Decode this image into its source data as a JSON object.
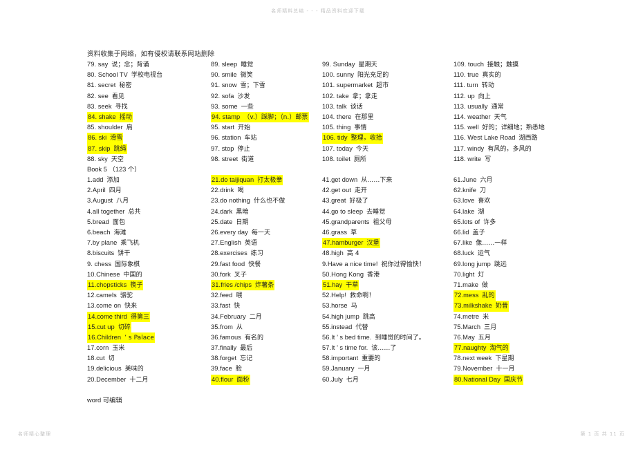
{
  "document": {
    "header_watermark": "名师精料总结 - - - 精品资料欢迎下载",
    "footer_left_watermark": "名师精心整理",
    "footer_right_watermark": "第 1 页 共 11 页",
    "notice": "资料收集于网络，如有侵权请联系网站删除",
    "book_heading": "Book 5  （123 个）",
    "edit_note": "word 可编辑"
  },
  "columns": [
    {
      "id": "column-1",
      "entries": [
        {
          "en": "79. say",
          "cn": "说；念；背诵",
          "hl": false
        },
        {
          "en": "80. School TV",
          "cn": "学校电视台",
          "hl": false
        },
        {
          "en": "81. secret",
          "cn": "秘密",
          "hl": false
        },
        {
          "en": "82. see",
          "cn": "看见",
          "hl": false
        },
        {
          "en": "83. seek",
          "cn": "寻找",
          "hl": false
        },
        {
          "en": "84. shake",
          "cn": "摇动",
          "hl": true
        },
        {
          "en": "85. shoulder",
          "cn": "肩",
          "hl": false
        },
        {
          "en": "86. ski",
          "cn": "滑雪",
          "hl": true
        },
        {
          "en": "87. skip",
          "cn": "跳绳",
          "hl": true
        },
        {
          "en": "88. sky",
          "cn": "天空",
          "hl": false
        },
        {
          "en": "__BOOK_HEAD__",
          "cn": "",
          "hl": false
        },
        {
          "en": "1.add",
          "cn": "添加",
          "hl": false
        },
        {
          "en": "2.April",
          "cn": "四月",
          "hl": false
        },
        {
          "en": "3.August",
          "cn": "八月",
          "hl": false
        },
        {
          "en": "4.all together",
          "cn": "总共",
          "hl": false
        },
        {
          "en": "5.bread",
          "cn": "面包",
          "hl": false
        },
        {
          "en": "6.beach",
          "cn": "海滩",
          "hl": false
        },
        {
          "en": "7.by plane",
          "cn": "乘飞机",
          "hl": false
        },
        {
          "en": "8.biscuits",
          "cn": "饼干",
          "hl": false
        },
        {
          "en": "9. chess",
          "cn": "国际象棋",
          "hl": false
        },
        {
          "en": "10.Chinese",
          "cn": "中国的",
          "hl": false
        },
        {
          "en": "11.chopsticks",
          "cn": "筷子",
          "hl": true
        },
        {
          "en": "12.camels",
          "cn": "骆驼",
          "hl": false
        },
        {
          "en": "13.come on",
          "cn": "快来",
          "hl": false
        },
        {
          "en": "14.come third",
          "cn": "得第三",
          "hl": true
        },
        {
          "en": "15.cut up",
          "cn": "切碎",
          "hl": true
        },
        {
          "en": "16.Children",
          "cn": "’  s Palace",
          "hl": true
        },
        {
          "en": "17.corn",
          "cn": "玉米",
          "hl": false
        },
        {
          "en": "18.cut",
          "cn": "切",
          "hl": false
        },
        {
          "en": "19.delicious",
          "cn": "美味的",
          "hl": false
        },
        {
          "en": "20.December",
          "cn": "十二月",
          "hl": false
        },
        {
          "en": "__EDIT_NOTE__",
          "cn": "",
          "hl": false
        }
      ]
    },
    {
      "id": "column-2",
      "entries": [
        {
          "en": "89. sleep",
          "cn": "睡觉",
          "hl": false
        },
        {
          "en": "90. smile",
          "cn": "微笑",
          "hl": false
        },
        {
          "en": "91. snow",
          "cn": "雪；下雪",
          "hl": false
        },
        {
          "en": "92. sofa",
          "cn": "沙发",
          "hl": false
        },
        {
          "en": "93. some",
          "cn": "一些",
          "hl": false
        },
        {
          "en": "94. stamp",
          "cn": "（v.）踩脚；（n.）邮票",
          "hl": true
        },
        {
          "en": "95. start",
          "cn": "开始",
          "hl": false
        },
        {
          "en": "96. station",
          "cn": "车站",
          "hl": false
        },
        {
          "en": "97. stop",
          "cn": "停止",
          "hl": false
        },
        {
          "en": "98. street",
          "cn": "街道",
          "hl": false
        },
        {
          "en": "__SPACER__",
          "cn": "",
          "hl": false
        },
        {
          "en": "21.do taijiquan",
          "cn": "打太极拳",
          "hl": true
        },
        {
          "en": "22.drink",
          "cn": "喝",
          "hl": false
        },
        {
          "en": "23.do nothing",
          "cn": "什么也不做",
          "hl": false
        },
        {
          "en": "24.dark",
          "cn": "黑暗",
          "hl": false
        },
        {
          "en": "25.date",
          "cn": "日期",
          "hl": false
        },
        {
          "en": "26.every day",
          "cn": "每一天",
          "hl": false
        },
        {
          "en": "27.English",
          "cn": "英语",
          "hl": false
        },
        {
          "en": "28.exercises",
          "cn": "练习",
          "hl": false
        },
        {
          "en": "29.fast food",
          "cn": "快餐",
          "hl": false
        },
        {
          "en": "30.fork",
          "cn": "叉子",
          "hl": false
        },
        {
          "en": "31.fries /chips",
          "cn": "炸薯条",
          "hl": true
        },
        {
          "en": "32.feed",
          "cn": "喂",
          "hl": false
        },
        {
          "en": "33.fast",
          "cn": "快",
          "hl": false
        },
        {
          "en": "34.February",
          "cn": "二月",
          "hl": false
        },
        {
          "en": "35.from",
          "cn": "从",
          "hl": false
        },
        {
          "en": "36.famous",
          "cn": "有名的",
          "hl": false
        },
        {
          "en": "37.finally",
          "cn": "最后",
          "hl": false
        },
        {
          "en": "38.forget",
          "cn": "忘记",
          "hl": false
        },
        {
          "en": "39.face",
          "cn": "脸",
          "hl": false
        },
        {
          "en": "40.flour",
          "cn": "面粉",
          "hl": true
        }
      ]
    },
    {
      "id": "column-3",
      "entries": [
        {
          "en": "99. Sunday",
          "cn": "星期天",
          "hl": false
        },
        {
          "en": "100. sunny",
          "cn": "阳光充足的",
          "hl": false
        },
        {
          "en": "101. supermarket",
          "cn": "超市",
          "hl": false
        },
        {
          "en": "102. take",
          "cn": "拿；拿走",
          "hl": false
        },
        {
          "en": "103. talk",
          "cn": "谈话",
          "hl": false
        },
        {
          "en": "104. there",
          "cn": "在那里",
          "hl": false
        },
        {
          "en": "105. thing",
          "cn": "事情",
          "hl": false
        },
        {
          "en": "106. tidy",
          "cn": "整理，收拾",
          "hl": true
        },
        {
          "en": "107. today",
          "cn": "今天",
          "hl": false
        },
        {
          "en": "108. toilet",
          "cn": "厕所",
          "hl": false
        },
        {
          "en": "__SPACER__",
          "cn": "",
          "hl": false
        },
        {
          "en": "41.get down",
          "cn": "从……下来",
          "hl": false
        },
        {
          "en": "42.get out",
          "cn": "走开",
          "hl": false
        },
        {
          "en": "43.great",
          "cn": "好极了",
          "hl": false
        },
        {
          "en": "44.go to sleep",
          "cn": "去睡觉",
          "hl": false
        },
        {
          "en": "45.grandparents",
          "cn": "祖父母",
          "hl": false
        },
        {
          "en": "46.grass",
          "cn": "草",
          "hl": false
        },
        {
          "en": "47.hamburger",
          "cn": "汉堡",
          "hl": true
        },
        {
          "en": "48.high",
          "cn": "高 4",
          "hl": false
        },
        {
          "en": "9.Have a nice time!",
          "cn": "祝你过得愉快！",
          "hl": false
        },
        {
          "en": "50.Hong Kong",
          "cn": "香港",
          "hl": false
        },
        {
          "en": "51.hay",
          "cn": "干草",
          "hl": true
        },
        {
          "en": "52.Help!",
          "cn": "救命啊！",
          "hl": false
        },
        {
          "en": "53.horse",
          "cn": "马",
          "hl": false
        },
        {
          "en": "54.high jump",
          "cn": "跳高",
          "hl": false
        },
        {
          "en": "55.instead",
          "cn": "代替",
          "hl": false
        },
        {
          "en": "56.It ’  s bed time.",
          "cn": "到睡觉的时间了。",
          "hl": false
        },
        {
          "en": "57.It ’  s time for.",
          "cn": "该……了",
          "hl": false
        },
        {
          "en": "58.important",
          "cn": "重要的",
          "hl": false
        },
        {
          "en": "59.January",
          "cn": "一月",
          "hl": false
        },
        {
          "en": "60.July",
          "cn": "七月",
          "hl": false
        }
      ]
    },
    {
      "id": "column-4",
      "entries": [
        {
          "en": "109. touch",
          "cn": "接触；触摸",
          "hl": false
        },
        {
          "en": "110. true",
          "cn": "真实的",
          "hl": false
        },
        {
          "en": "111. turn",
          "cn": "转动",
          "hl": false
        },
        {
          "en": "112. up",
          "cn": "向上",
          "hl": false
        },
        {
          "en": "113. usually",
          "cn": "通常",
          "hl": false
        },
        {
          "en": "114. weather",
          "cn": "天气",
          "hl": false
        },
        {
          "en": "115. well",
          "cn": "好的；详细地；熟悉地",
          "hl": false
        },
        {
          "en": "116. West Lake Road",
          "cn": "湖西路",
          "hl": false
        },
        {
          "en": "117. windy",
          "cn": "有风的，多风的",
          "hl": false
        },
        {
          "en": "118. write",
          "cn": "写",
          "hl": false
        },
        {
          "en": "__SPACER__",
          "cn": "",
          "hl": false
        },
        {
          "en": "61.June",
          "cn": "六月",
          "hl": false
        },
        {
          "en": "62.knife",
          "cn": "刀",
          "hl": false
        },
        {
          "en": "63.love",
          "cn": "喜欢",
          "hl": false
        },
        {
          "en": "64.lake",
          "cn": "湖",
          "hl": false
        },
        {
          "en": "65.lots of",
          "cn": "许多",
          "hl": false
        },
        {
          "en": "66.lid",
          "cn": "盖子",
          "hl": false
        },
        {
          "en": "67.like",
          "cn": "像……一样",
          "hl": false
        },
        {
          "en": "68.luck",
          "cn": "运气",
          "hl": false
        },
        {
          "en": "69.long jump",
          "cn": "跳远",
          "hl": false
        },
        {
          "en": "70.light",
          "cn": "灯",
          "hl": false
        },
        {
          "en": "71.make",
          "cn": "做",
          "hl": false
        },
        {
          "en": "72.mess",
          "cn": "乱的",
          "hl": true
        },
        {
          "en": "73.milkshake",
          "cn": "奶昔",
          "hl": true
        },
        {
          "en": "74.metre",
          "cn": "米",
          "hl": false
        },
        {
          "en": "75.March",
          "cn": "三月",
          "hl": false
        },
        {
          "en": "76.May",
          "cn": "五月",
          "hl": false
        },
        {
          "en": "77.naughty",
          "cn": "淘气的",
          "hl": true
        },
        {
          "en": "78.next week",
          "cn": "下星期",
          "hl": false
        },
        {
          "en": "79.November",
          "cn": "十一月",
          "hl": false
        },
        {
          "en": "80.National Day",
          "cn": "国庆节",
          "hl": true
        }
      ]
    }
  ]
}
